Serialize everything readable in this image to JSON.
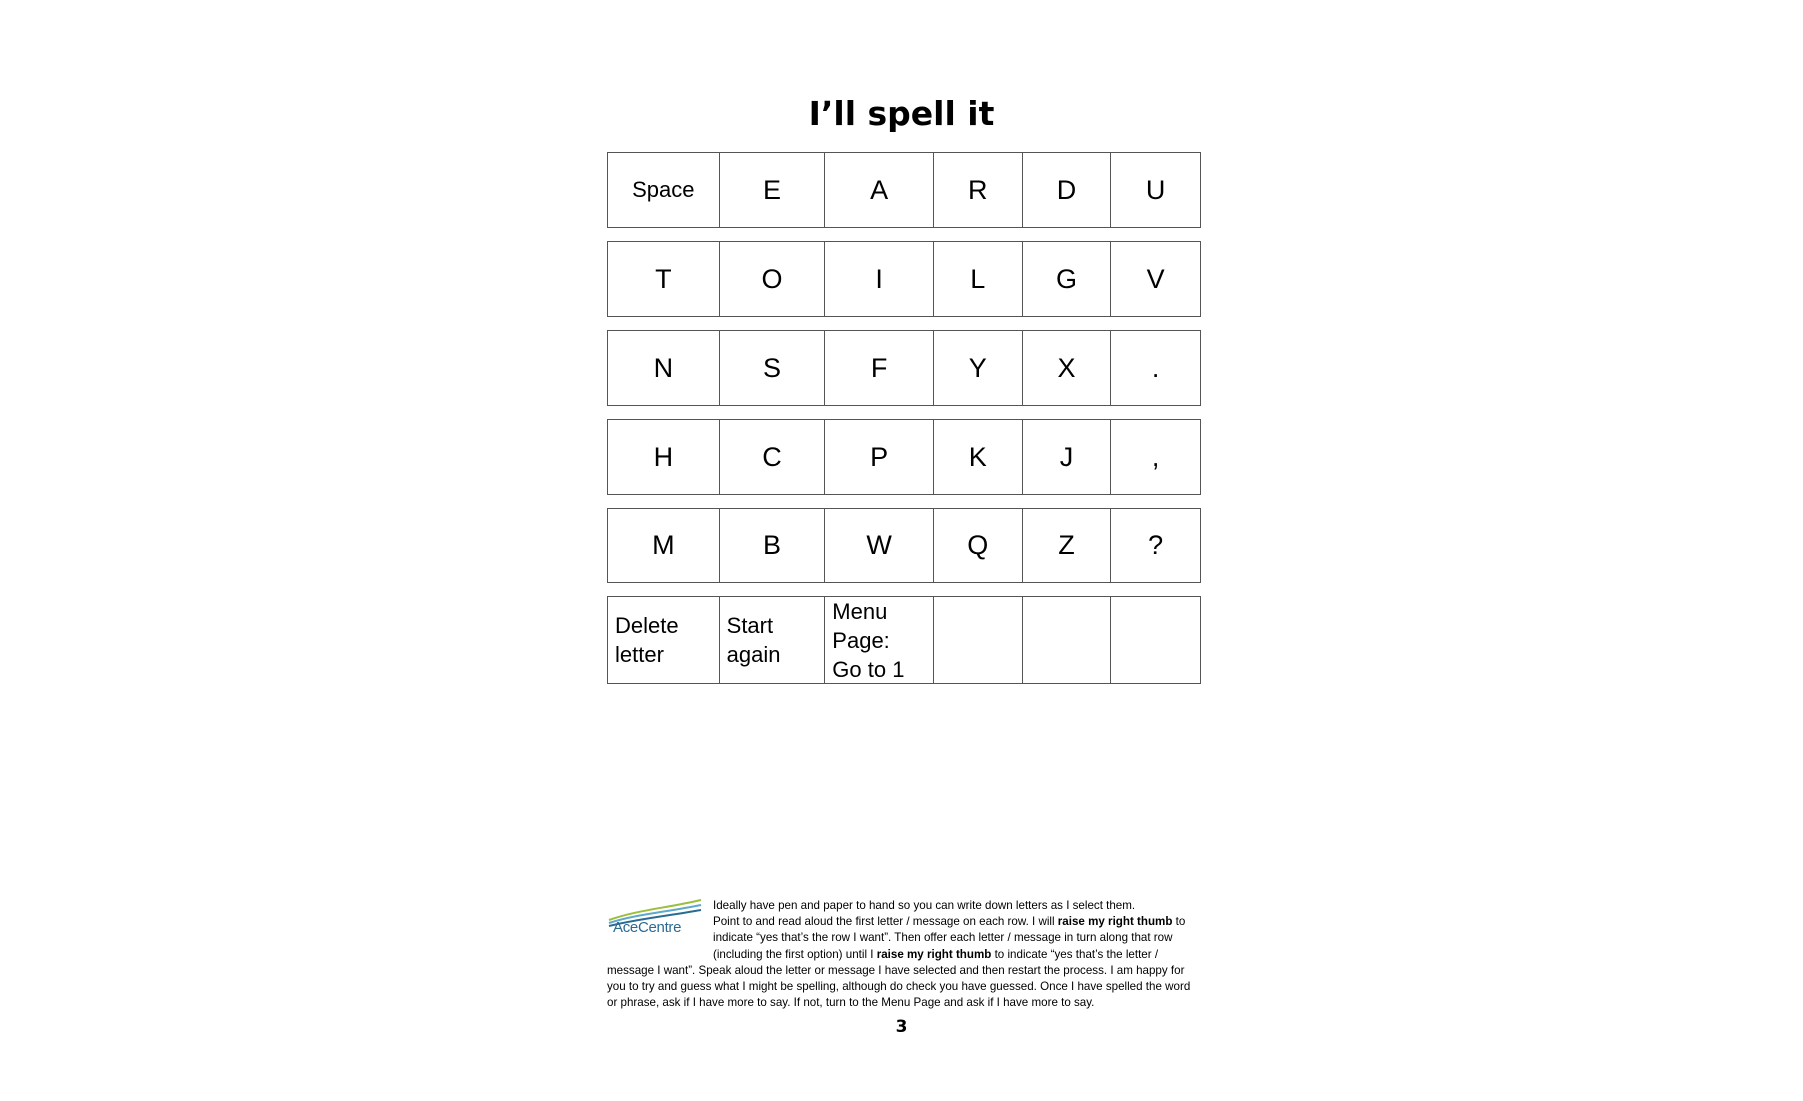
{
  "title": "I’ll spell it",
  "grid": {
    "rows": [
      [
        "Space",
        "E",
        "A",
        "R",
        "D",
        "U"
      ],
      [
        "T",
        "O",
        "I",
        "L",
        "G",
        "V"
      ],
      [
        "N",
        "S",
        "F",
        "Y",
        "X",
        "."
      ],
      [
        "H",
        "C",
        "P",
        "K",
        "J",
        ","
      ],
      [
        "M",
        "B",
        "W",
        "Q",
        "Z",
        "?"
      ],
      [
        "Delete\nletter",
        "Start\nagain",
        "Menu\nPage:\nGo to 1",
        "",
        "",
        ""
      ]
    ]
  },
  "logo": {
    "text": "AceCentre",
    "colors": [
      "#2a6a93",
      "#5fa8c9",
      "#9bbf3b"
    ]
  },
  "footer": {
    "line1": "Ideally have pen and paper to hand so you can write down letters as I select them.",
    "p1": "Point to and read aloud the first letter / message on each row.  I will ",
    "b1": "raise my right thumb",
    "p2": " to indicate “yes that’s the row I want”. Then offer each letter / message in turn along that row (including the first option) until I ",
    "b2": "raise my right thumb",
    "p3": " to indicate “yes that’s the letter / message I want”. Speak aloud the letter or message I have selected and then restart the process.  I am happy for you to try and guess what I might be spelling, although do check you have guessed.  Once I have spelled the word or phrase, ask if I have more to say.   If not, turn to the Menu Page and ask if I have more to say."
  },
  "page_number": "3"
}
